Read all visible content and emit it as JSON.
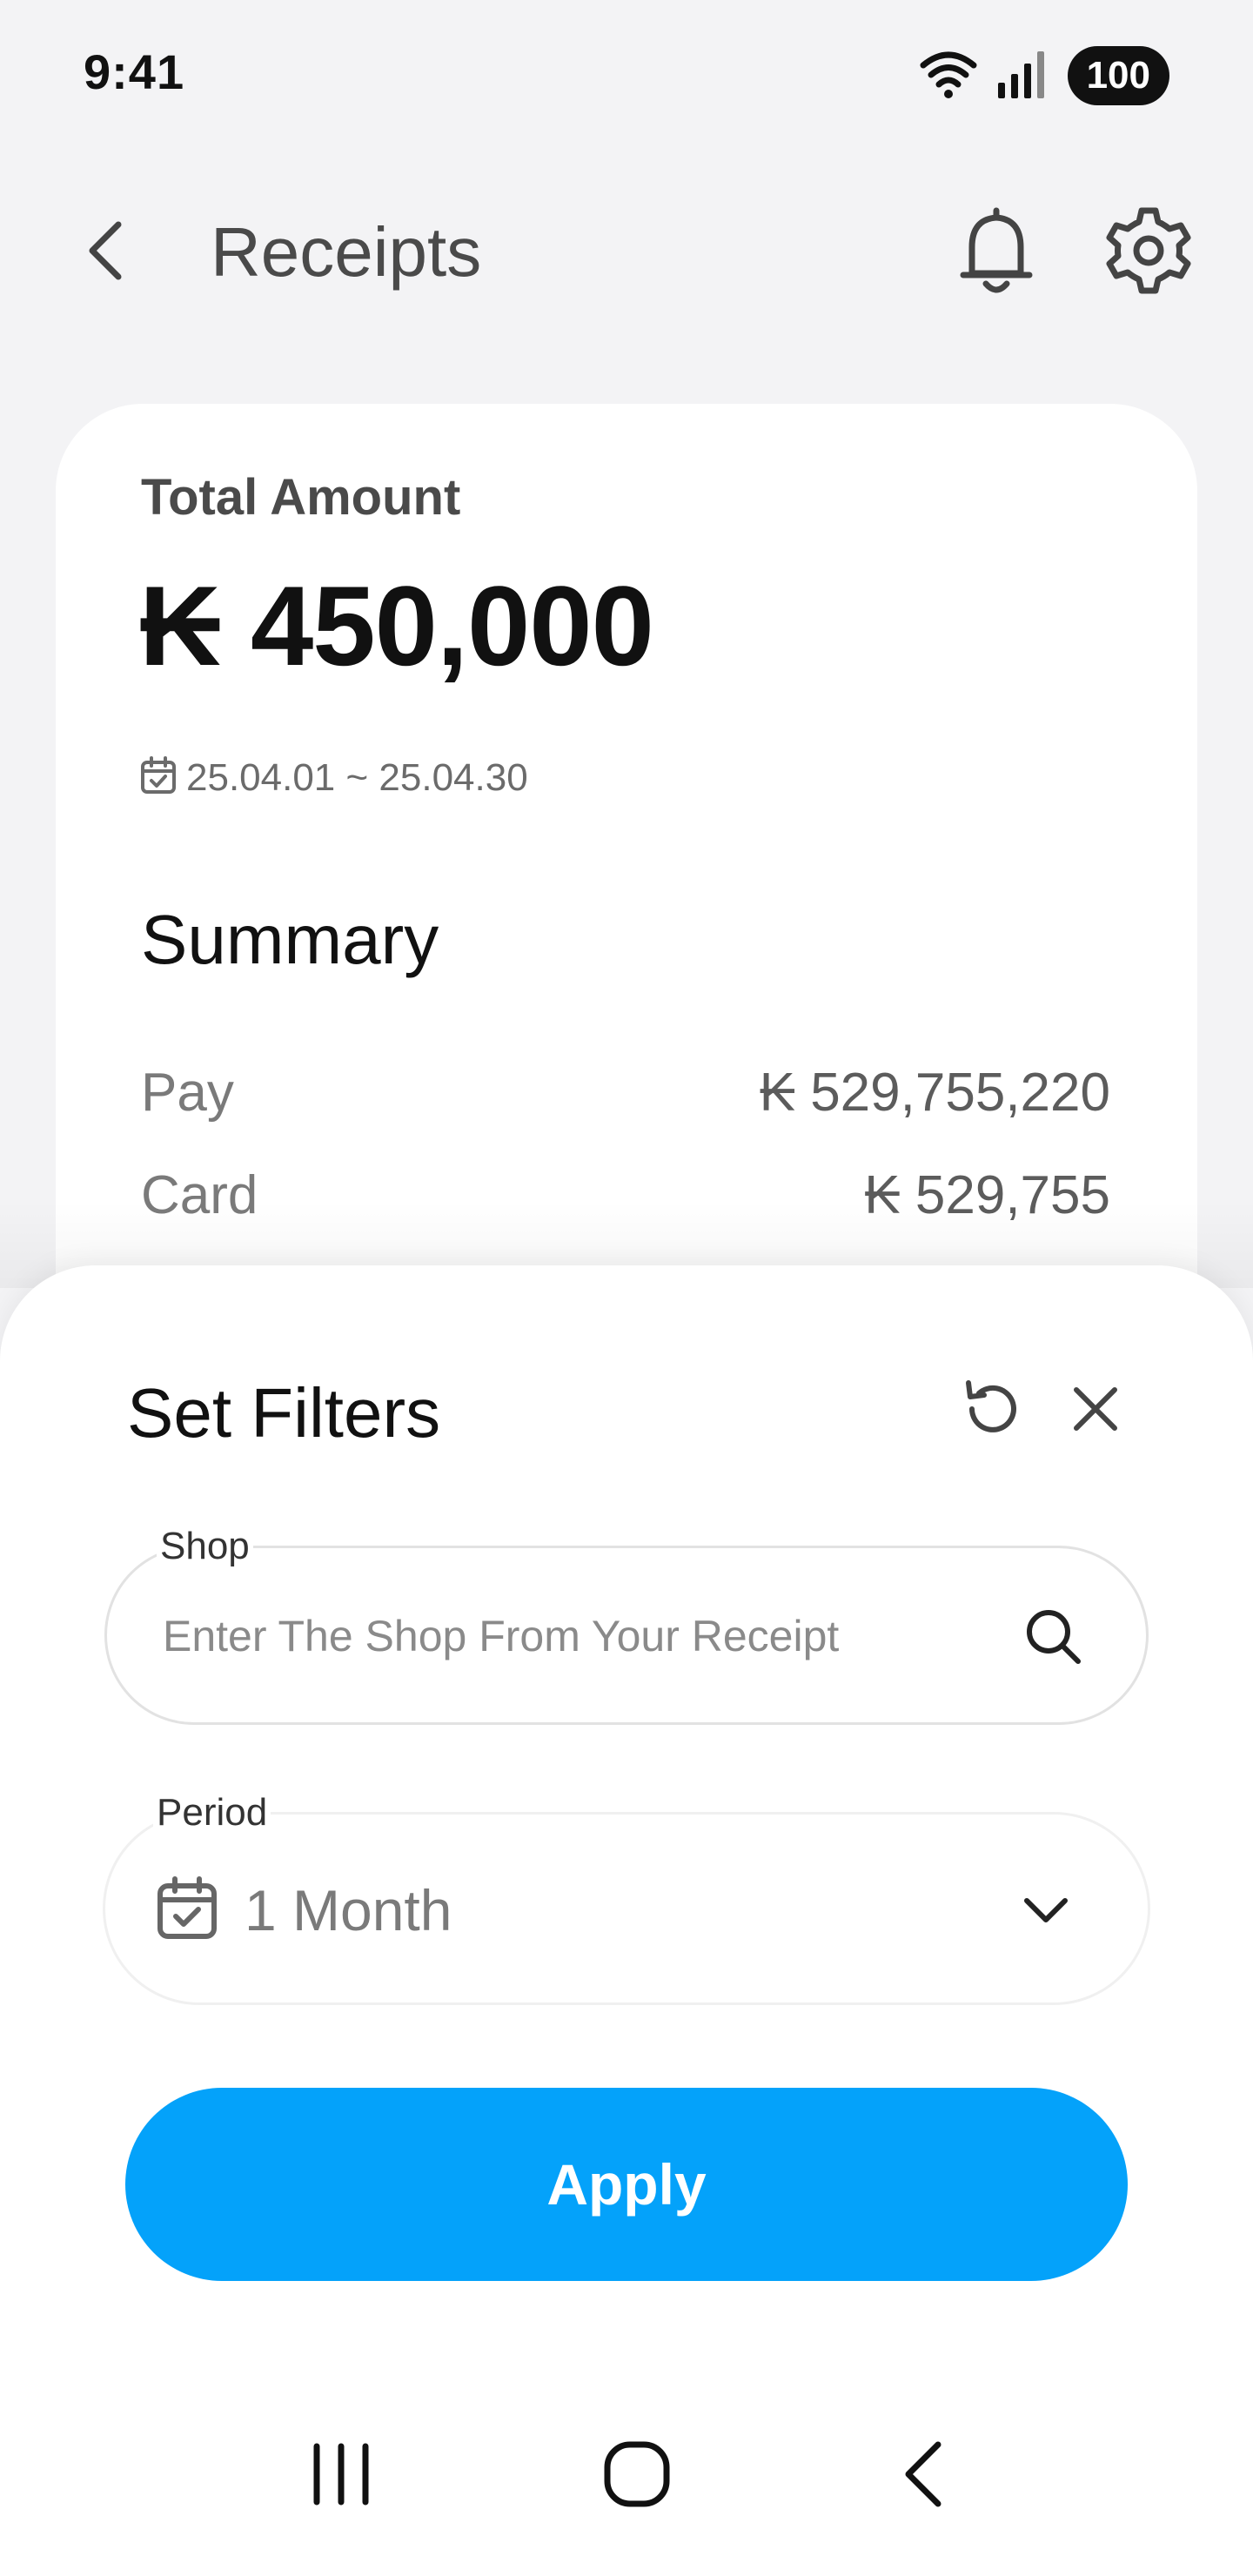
{
  "status_bar": {
    "time": "9:41",
    "battery": "100"
  },
  "app_bar": {
    "title": "Receipts"
  },
  "card": {
    "total_label": "Total Amount",
    "total_amount": "₭ 450,000",
    "date_range": "25.04.01 ~ 25.04.30",
    "summary_title": "Summary",
    "rows": [
      {
        "label": "Pay",
        "value": "₭ 529,755,220"
      },
      {
        "label": "Card",
        "value": "₭ 529,755"
      }
    ]
  },
  "filters": {
    "title": "Set Filters",
    "shop": {
      "label": "Shop",
      "placeholder": "Enter The Shop From Your Receipt"
    },
    "period": {
      "label": "Period",
      "value": "1 Month"
    },
    "apply_label": "Apply"
  },
  "colors": {
    "accent": "#04a2fa",
    "background": "#f3f3f5",
    "card": "#ffffff"
  }
}
